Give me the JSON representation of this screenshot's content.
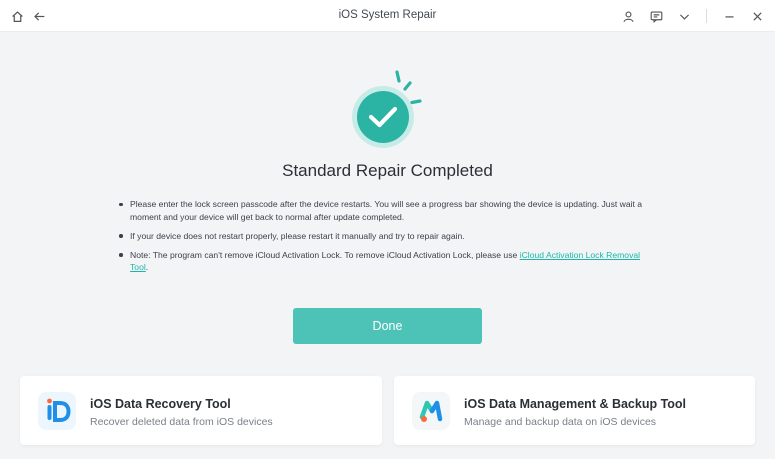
{
  "window": {
    "title": "iOS System Repair",
    "icons": [
      "home-icon",
      "back-arrow-icon",
      "user-icon",
      "feedback-icon",
      "chevron-down-icon",
      "minimize-icon",
      "close-icon"
    ]
  },
  "main": {
    "heading": "Standard Repair Completed",
    "notes": {
      "n1": "Please enter the lock screen passcode after the device restarts. You will see a progress bar showing the device is updating. Just wait a moment and your device will get back to normal after update completed.",
      "n2": "If your device does not restart properly, please restart it manually and try to repair again.",
      "n3_prefix": "Note: The program can't remove iCloud Activation Lock. To remove iCloud Activation Lock, please use ",
      "n3_link": "iCloud Activation Lock Removal Tool",
      "n3_suffix": "."
    },
    "done_label": "Done"
  },
  "cards": [
    {
      "title": "iOS Data Recovery Tool",
      "desc": "Recover deleted data from iOS devices"
    },
    {
      "title": "iOS Data Management & Backup Tool",
      "desc": "Manage and backup data on iOS devices"
    }
  ],
  "colors": {
    "accent": "#4dc3b8",
    "success": "#2bb3a4",
    "link": "#19b8a6",
    "card1_logo": "#1f8fe8",
    "card2_logo_a": "#ff6a3d",
    "card2_logo_b": "#2fc6b3"
  }
}
